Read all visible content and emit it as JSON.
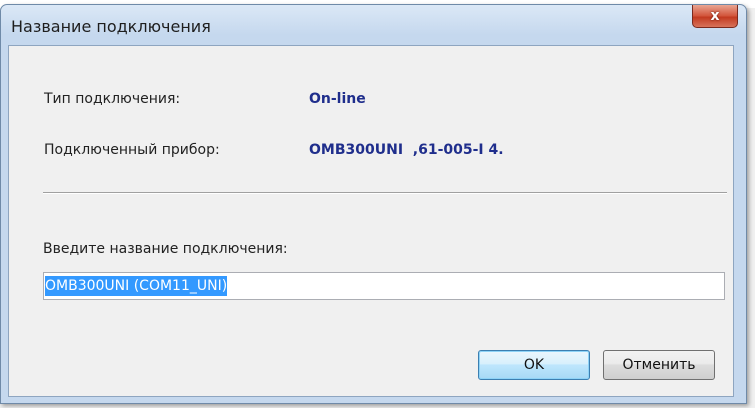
{
  "window": {
    "title": "Название подключения",
    "close_label": "x"
  },
  "info": {
    "type_label": "Тип подключения:",
    "type_value": "On-line",
    "device_label": "Подключенный прибор:",
    "device_value": "OMB300UNI  ,61-005-I 4."
  },
  "form": {
    "name_label": "Введите название подключения:",
    "name_value": "OMB300UNI (COM11_UNI)"
  },
  "buttons": {
    "ok_label": "OK",
    "cancel_label": "Отменить"
  },
  "colors": {
    "value_text": "#1f2e8c",
    "selection": "#3399ff",
    "frame": "#c5d8ee"
  }
}
